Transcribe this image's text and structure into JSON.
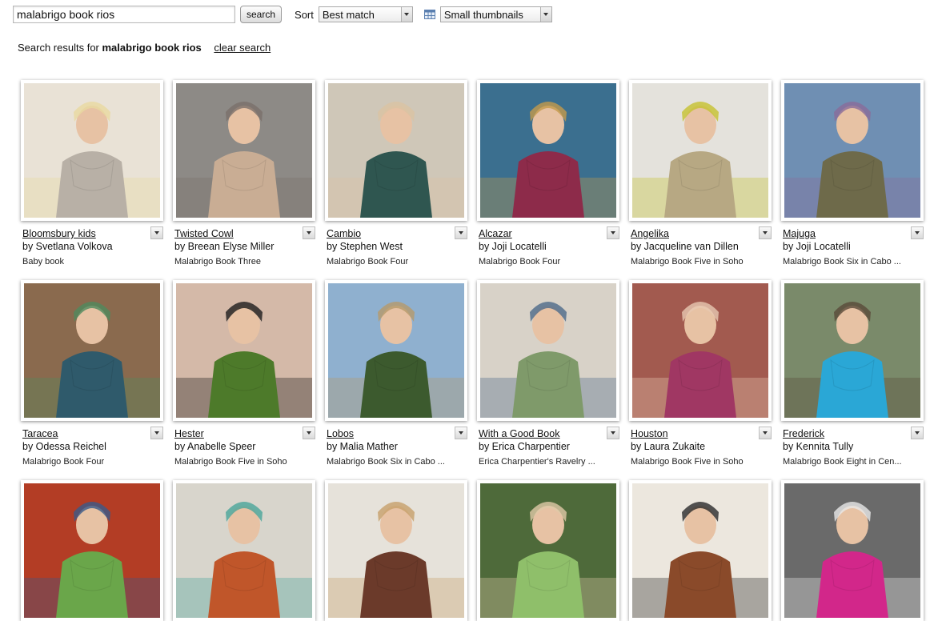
{
  "toolbar": {
    "query": "malabrigo book rios",
    "search_label": "search",
    "sort_label": "Sort",
    "sort_value": "Best match",
    "view_value": "Small thumbnails"
  },
  "results": {
    "prefix": "Search results for",
    "query": "malabrigo book rios",
    "clear_label": "clear search"
  },
  "items": [
    {
      "title": "Bloomsbury kids",
      "author": "by Svetlana Volkova",
      "source": "Baby book",
      "bg": "#e9e2d6",
      "fg": "#b8b0a6",
      "accent": "#e8d9a0"
    },
    {
      "title": "Twisted Cowl",
      "author": "by Breean Elyse Miller",
      "source": "Malabrigo Book Three",
      "bg": "#8d8a86",
      "fg": "#c9ad94",
      "accent": "#7a6f6a"
    },
    {
      "title": "Cambio",
      "author": "by Stephen West",
      "source": "Malabrigo Book Four",
      "bg": "#cfc7b8",
      "fg": "#2f5650",
      "accent": "#d9c3a2"
    },
    {
      "title": "Alcazar",
      "author": "by Joji Locatelli",
      "source": "Malabrigo Book Four",
      "bg": "#3b6f8f",
      "fg": "#8d2b4a",
      "accent": "#c49a4a"
    },
    {
      "title": "Angelika",
      "author": "by Jacqueline van Dillen",
      "source": "Malabrigo Book Five in Soho",
      "bg": "#e4e2dc",
      "fg": "#b7a883",
      "accent": "#c6c230"
    },
    {
      "title": "Majuga",
      "author": "by Joji Locatelli",
      "source": "Malabrigo Book Six in Cabo ...",
      "bg": "#6f8fb3",
      "fg": "#6e6a4a",
      "accent": "#8a6c9a"
    },
    {
      "title": "Taracea",
      "author": "by Odessa Reichel",
      "source": "Malabrigo Book Four",
      "bg": "#8a6a4e",
      "fg": "#2f5a6b",
      "accent": "#4f8a5e"
    },
    {
      "title": "Hester",
      "author": "by Anabelle Speer",
      "source": "Malabrigo Book Five in Soho",
      "bg": "#d4b9a8",
      "fg": "#4d7a2a",
      "accent": "#1d1d1d"
    },
    {
      "title": "Lobos",
      "author": "by Malia Mather",
      "source": "Malabrigo Book Six in Cabo ...",
      "bg": "#8fb0cf",
      "fg": "#3c5a2e",
      "accent": "#b59a6a"
    },
    {
      "title": "With a Good Book",
      "author": "by Erica Charpentier",
      "source": "Erica Charpentier's Ravelry ...",
      "bg": "#d8d2c8",
      "fg": "#7f9a6a",
      "accent": "#4d6a8a"
    },
    {
      "title": "Houston",
      "author": "by Laura Zukaite",
      "source": "Malabrigo Book Five in Soho",
      "bg": "#a25a4f",
      "fg": "#a03763",
      "accent": "#e7c8b2"
    },
    {
      "title": "Frederick",
      "author": "by Kennita Tully",
      "source": "Malabrigo Book Eight in Cen...",
      "bg": "#7a8a6a",
      "fg": "#2aa7d6",
      "accent": "#5a4a3a"
    },
    {
      "title": "",
      "author": "",
      "source": "",
      "bg": "#b33d25",
      "fg": "#6aa64a",
      "accent": "#3a5a8a"
    },
    {
      "title": "",
      "author": "",
      "source": "",
      "bg": "#d8d5cc",
      "fg": "#c0562a",
      "accent": "#4aa59a"
    },
    {
      "title": "",
      "author": "",
      "source": "",
      "bg": "#e6e2da",
      "fg": "#6b3a2a",
      "accent": "#c7a06a"
    },
    {
      "title": "",
      "author": "",
      "source": "",
      "bg": "#4e6a3a",
      "fg": "#8fbf6a",
      "accent": "#e0c9a8"
    },
    {
      "title": "",
      "author": "",
      "source": "",
      "bg": "#ece7de",
      "fg": "#8a4a2a",
      "accent": "#2a2a2a"
    },
    {
      "title": "",
      "author": "",
      "source": "",
      "bg": "#6a6a6a",
      "fg": "#d2278a",
      "accent": "#e8e8e8"
    }
  ],
  "icons": {
    "view": "grid-view-icon",
    "dropdown": "chevron-down-icon"
  }
}
